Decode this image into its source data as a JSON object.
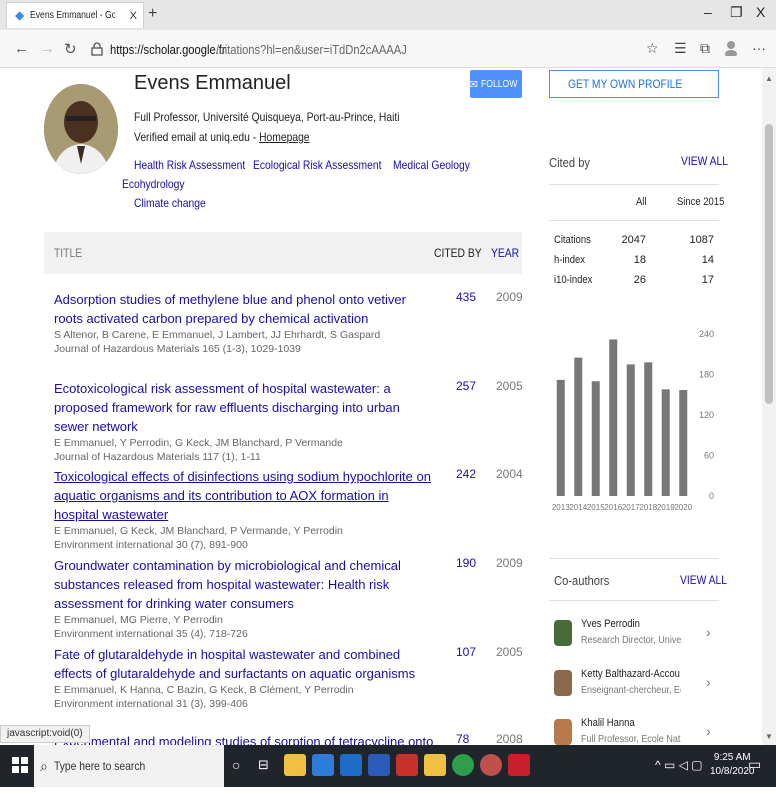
{
  "browser": {
    "tab_title": "Evens Emmanuel - Google Schol",
    "tab_close": "X",
    "new_tab": "+",
    "url_host": "https://scholar.google.fr",
    "url_path": "/citations?hl=en&user=iTdDn2cAAAAJ",
    "win_min": "–",
    "win_max": "❐",
    "win_close": "X"
  },
  "profile": {
    "name": "Evens Emmanuel",
    "affiliation": "Full Professor, Université Quisqueya, Port-au-Prince, Haiti",
    "email_text": "Verified email at uniq.edu - ",
    "homepage": "Homepage",
    "interests": [
      "Health Risk Assessment",
      "Ecological Risk Assessment",
      "Medical Geology",
      "Ecohydrology",
      "Climate change"
    ],
    "follow_label": "FOLLOW",
    "get_profile_label": "GET MY OWN PROFILE"
  },
  "table": {
    "col_title": "TITLE",
    "col_cited": "CITED BY",
    "col_year": "YEAR",
    "articles": [
      {
        "title": "Adsorption studies of methylene blue and phenol onto vetiver roots activated carbon prepared by chemical activation",
        "authors": "S Altenor, B Carene, E Emmanuel, J Lambert, JJ Ehrhardt, S Gaspard",
        "venue": "Journal of Hazardous Materials 165 (1-3), 1029-1039",
        "cited": "435",
        "year": "2009"
      },
      {
        "title": "Ecotoxicological risk assessment of hospital wastewater: a proposed framework for raw effluents discharging into urban sewer network",
        "authors": "E Emmanuel, Y Perrodin, G Keck, JM Blanchard, P Vermande",
        "venue": "Journal of Hazardous Materials 117 (1), 1-11",
        "cited": "257",
        "year": "2005"
      },
      {
        "title": "Toxicological effects of disinfections using sodium hypochlorite on aquatic organisms and its contribution to AOX formation in hospital wastewater",
        "authors": "E Emmanuel, G Keck, JM Blanchard, P Vermande, Y Perrodin",
        "venue": "Environment international 30 (7), 891-900",
        "cited": "242",
        "year": "2004"
      },
      {
        "title": "Groundwater contamination by microbiological and chemical substances released from hospital wastewater: Health risk assessment for drinking water consumers",
        "authors": "E Emmanuel, MG Pierre, Y Perrodin",
        "venue": "Environment international 35 (4), 718-726",
        "cited": "190",
        "year": "2009"
      },
      {
        "title": "Fate of glutaraldehyde in hospital wastewater and combined effects of glutaraldehyde and surfactants on aquatic organisms",
        "authors": "E Emmanuel, K Hanna, C Bazin, G Keck, B Clément, Y Perrodin",
        "venue": "Environment international 31 (3), 399-406",
        "cited": "107",
        "year": "2005"
      },
      {
        "title": "Experimental and modeling studies of sorption of tetracycline onto iron oxides-coated quartz",
        "authors": "",
        "venue": "",
        "cited": "78",
        "year": "2008"
      }
    ]
  },
  "cited_by": {
    "heading": "Cited by",
    "view_all": "VIEW ALL",
    "col_all": "All",
    "col_since": "Since 2015",
    "rows": [
      {
        "label": "Citations",
        "all": "2047",
        "since": "1087"
      },
      {
        "label": "h-index",
        "all": "18",
        "since": "14"
      },
      {
        "label": "i10-index",
        "all": "26",
        "since": "17"
      }
    ]
  },
  "chart_data": {
    "type": "bar",
    "categories": [
      "2013",
      "2014",
      "2015",
      "2016",
      "2017",
      "2018",
      "2019",
      "2020"
    ],
    "values": [
      172,
      205,
      170,
      232,
      195,
      198,
      158,
      157
    ],
    "y_ticks": [
      "240",
      "180",
      "120",
      "60",
      "0"
    ],
    "ylim": [
      0,
      240
    ],
    "bar_color": "#777777"
  },
  "coauthors": {
    "heading": "Co-authors",
    "view_all": "VIEW ALL",
    "items": [
      {
        "name": "Yves Perrodin",
        "desc": "Research Director, University of ..."
      },
      {
        "name": "Ketty Balthazard-Accou",
        "desc": "Enseignant-chercheur, Ecole doc..."
      },
      {
        "name": "Khalil Hanna",
        "desc": "Full Professor, Ecole Nationale S..."
      }
    ]
  },
  "status_text": "javascript:void(0)",
  "taskbar": {
    "search_placeholder": "Type here to search",
    "time": "9:25 AM",
    "date": "10/8/2020"
  },
  "colors": {
    "link": "#1a0dab",
    "accent": "#4d90fe",
    "taskbar": "#20252b"
  }
}
